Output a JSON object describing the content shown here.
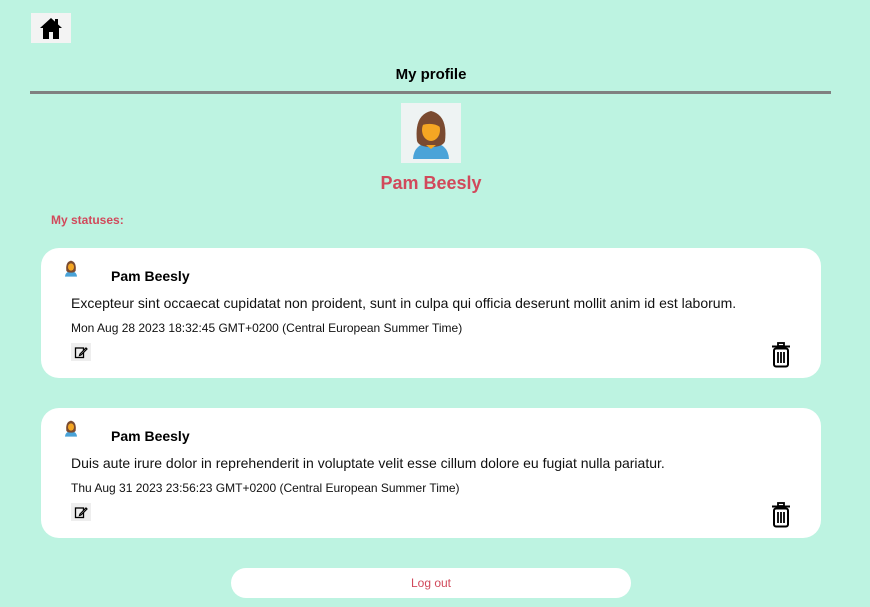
{
  "header": {
    "title": "My profile",
    "home_icon": "home-icon"
  },
  "profile": {
    "name": "Pam Beesly",
    "avatar_icon": "user-avatar-icon"
  },
  "statuses": {
    "heading": "My statuses:",
    "items": [
      {
        "author": "Pam Beesly",
        "text": "Excepteur sint occaecat cupidatat non proident, sunt in culpa qui officia deserunt mollit anim id est laborum.",
        "date": "Mon Aug 28 2023 18:32:45 GMT+0200 (Central European Summer Time)",
        "edit_icon": "edit-icon",
        "delete_icon": "trash-icon"
      },
      {
        "author": "Pam Beesly",
        "text": "Duis aute irure dolor in reprehenderit in voluptate velit esse cillum dolore eu fugiat nulla pariatur.",
        "date": "Thu Aug 31 2023 23:56:23 GMT+0200 (Central European Summer Time)",
        "edit_icon": "edit-icon",
        "delete_icon": "trash-icon"
      }
    ]
  },
  "logout": {
    "label": "Log out"
  },
  "colors": {
    "background": "#bdf3e1",
    "accent": "#d1495b",
    "rule": "#808080",
    "card": "#ffffff"
  }
}
